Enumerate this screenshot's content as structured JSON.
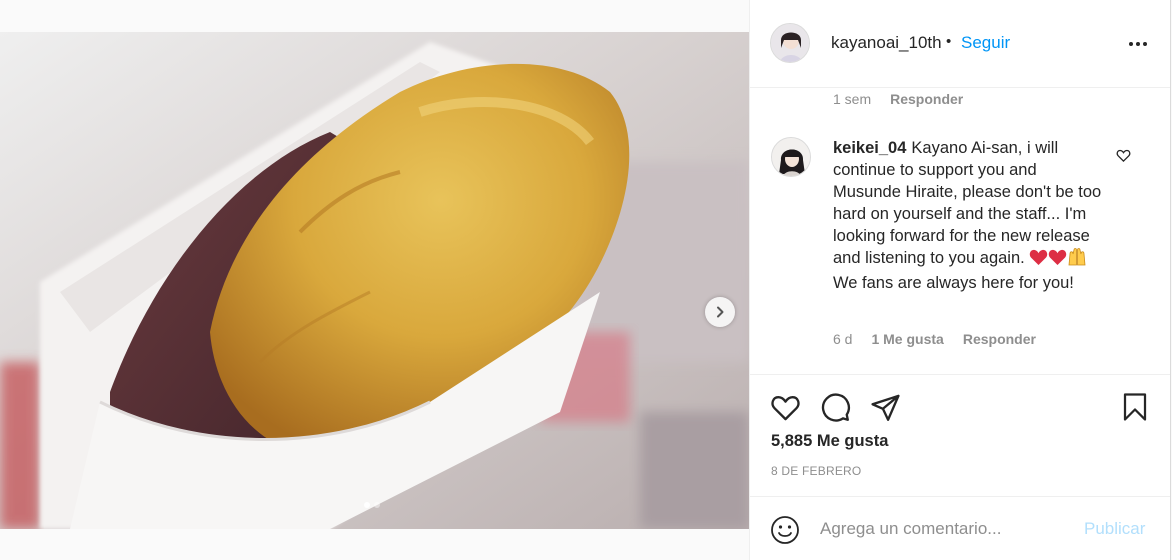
{
  "post": {
    "image_description_icon": "sweet-potato-photo",
    "carousel": {
      "total": 2,
      "active": 1
    }
  },
  "header": {
    "username": "kayanoai_10th",
    "separator": "•",
    "follow_label": "Seguir"
  },
  "comments": {
    "prev_comment_meta": {
      "time": "1 sem",
      "reply": "Responder"
    },
    "items": [
      {
        "username": "keikei_04",
        "text_part1": "Kayano Ai-san, i will continue to support you and Musunde Hiraite, please don't be too hard on yourself and the staff... I'm looking forward for the new release and listening to you again.",
        "emojis": [
          "red-heart",
          "red-heart",
          "raising-hands"
        ],
        "text_part2": "We fans are always here for you!",
        "time": "6 d",
        "likes": "1 Me gusta",
        "reply": "Responder"
      }
    ]
  },
  "actions": {
    "likes": "5,885 Me gusta",
    "date": "8 DE FEBRERO"
  },
  "add_comment": {
    "placeholder": "Agrega un comentario...",
    "publish": "Publicar"
  },
  "colors": {
    "link": "#0095f6",
    "publish_disabled": "#b2dffc",
    "muted": "#8e8e8e",
    "heart": "#e0245e"
  }
}
